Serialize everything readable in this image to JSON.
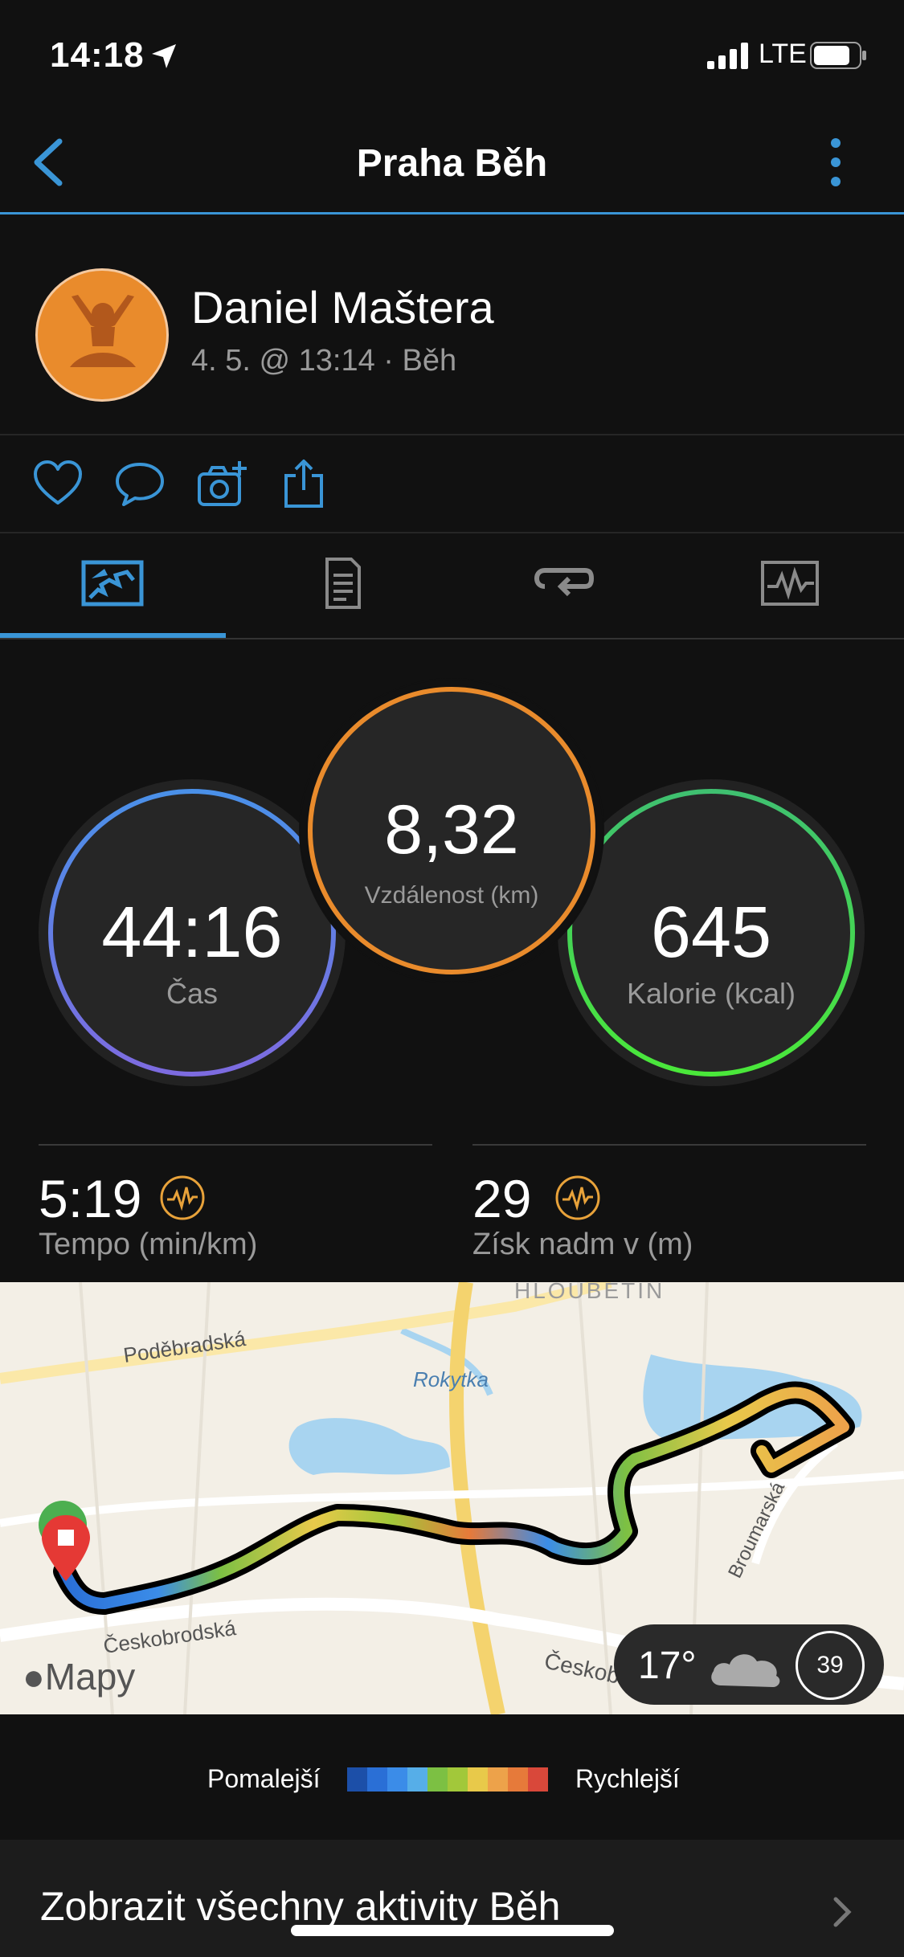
{
  "status_bar": {
    "time": "14:18",
    "network": "LTE"
  },
  "header": {
    "title": "Praha Běh"
  },
  "profile": {
    "name": "Daniel Maštera",
    "meta": "4. 5. @ 13:14 · Běh"
  },
  "stats": {
    "distance": {
      "value": "8,32",
      "label": "Vzdálenost (km)"
    },
    "time": {
      "value": "44:16",
      "label": "Čas"
    },
    "calories": {
      "value": "645",
      "label": "Kalorie (kcal)"
    }
  },
  "metrics": [
    {
      "value": "5:19",
      "label": "Tempo (min/km)"
    },
    {
      "value": "29",
      "label": "Získ nadm v (m)"
    }
  ],
  "map": {
    "labels": {
      "district": "HLOUBĚTÍN",
      "street1": "Poděbradská",
      "river": "Rokytka",
      "street2": "Českobrodská",
      "street3": "Broumarská",
      "street4": "Českob"
    },
    "brand": "Mapy",
    "weather_temp": "17°",
    "weather_index": "39"
  },
  "legend": {
    "slow": "Pomalejší",
    "fast": "Rychlejší",
    "colors": [
      "#1c4fa8",
      "#2a6fd6",
      "#3b8ce8",
      "#56aee8",
      "#7cc043",
      "#a2c83a",
      "#e8c94a",
      "#eda24a",
      "#e67a3a",
      "#d9483a"
    ]
  },
  "show_all": {
    "label": "Zobrazit všechny aktivity Běh"
  },
  "colors": {
    "accent": "#3a95d6",
    "distance_ring": "#e98b2c",
    "time_ring": "#5a8ee6",
    "calories_ring": "#4ad84a",
    "icon_orange": "#e8a23a"
  }
}
